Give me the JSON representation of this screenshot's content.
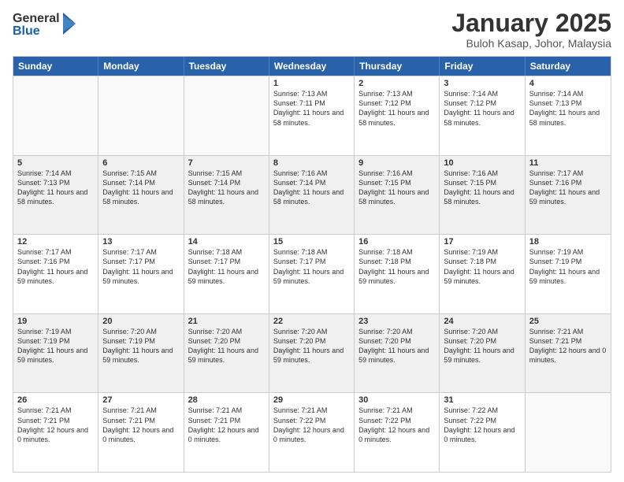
{
  "logo": {
    "general": "General",
    "blue": "Blue"
  },
  "header": {
    "title": "January 2025",
    "subtitle": "Buloh Kasap, Johor, Malaysia"
  },
  "days_of_week": [
    "Sunday",
    "Monday",
    "Tuesday",
    "Wednesday",
    "Thursday",
    "Friday",
    "Saturday"
  ],
  "weeks": [
    [
      {
        "day": "",
        "info": ""
      },
      {
        "day": "",
        "info": ""
      },
      {
        "day": "",
        "info": ""
      },
      {
        "day": "1",
        "info": "Sunrise: 7:13 AM\nSunset: 7:11 PM\nDaylight: 11 hours and 58 minutes."
      },
      {
        "day": "2",
        "info": "Sunrise: 7:13 AM\nSunset: 7:12 PM\nDaylight: 11 hours and 58 minutes."
      },
      {
        "day": "3",
        "info": "Sunrise: 7:14 AM\nSunset: 7:12 PM\nDaylight: 11 hours and 58 minutes."
      },
      {
        "day": "4",
        "info": "Sunrise: 7:14 AM\nSunset: 7:13 PM\nDaylight: 11 hours and 58 minutes."
      }
    ],
    [
      {
        "day": "5",
        "info": "Sunrise: 7:14 AM\nSunset: 7:13 PM\nDaylight: 11 hours and 58 minutes."
      },
      {
        "day": "6",
        "info": "Sunrise: 7:15 AM\nSunset: 7:14 PM\nDaylight: 11 hours and 58 minutes."
      },
      {
        "day": "7",
        "info": "Sunrise: 7:15 AM\nSunset: 7:14 PM\nDaylight: 11 hours and 58 minutes."
      },
      {
        "day": "8",
        "info": "Sunrise: 7:16 AM\nSunset: 7:14 PM\nDaylight: 11 hours and 58 minutes."
      },
      {
        "day": "9",
        "info": "Sunrise: 7:16 AM\nSunset: 7:15 PM\nDaylight: 11 hours and 58 minutes."
      },
      {
        "day": "10",
        "info": "Sunrise: 7:16 AM\nSunset: 7:15 PM\nDaylight: 11 hours and 58 minutes."
      },
      {
        "day": "11",
        "info": "Sunrise: 7:17 AM\nSunset: 7:16 PM\nDaylight: 11 hours and 59 minutes."
      }
    ],
    [
      {
        "day": "12",
        "info": "Sunrise: 7:17 AM\nSunset: 7:16 PM\nDaylight: 11 hours and 59 minutes."
      },
      {
        "day": "13",
        "info": "Sunrise: 7:17 AM\nSunset: 7:17 PM\nDaylight: 11 hours and 59 minutes."
      },
      {
        "day": "14",
        "info": "Sunrise: 7:18 AM\nSunset: 7:17 PM\nDaylight: 11 hours and 59 minutes."
      },
      {
        "day": "15",
        "info": "Sunrise: 7:18 AM\nSunset: 7:17 PM\nDaylight: 11 hours and 59 minutes."
      },
      {
        "day": "16",
        "info": "Sunrise: 7:18 AM\nSunset: 7:18 PM\nDaylight: 11 hours and 59 minutes."
      },
      {
        "day": "17",
        "info": "Sunrise: 7:19 AM\nSunset: 7:18 PM\nDaylight: 11 hours and 59 minutes."
      },
      {
        "day": "18",
        "info": "Sunrise: 7:19 AM\nSunset: 7:19 PM\nDaylight: 11 hours and 59 minutes."
      }
    ],
    [
      {
        "day": "19",
        "info": "Sunrise: 7:19 AM\nSunset: 7:19 PM\nDaylight: 11 hours and 59 minutes."
      },
      {
        "day": "20",
        "info": "Sunrise: 7:20 AM\nSunset: 7:19 PM\nDaylight: 11 hours and 59 minutes."
      },
      {
        "day": "21",
        "info": "Sunrise: 7:20 AM\nSunset: 7:20 PM\nDaylight: 11 hours and 59 minutes."
      },
      {
        "day": "22",
        "info": "Sunrise: 7:20 AM\nSunset: 7:20 PM\nDaylight: 11 hours and 59 minutes."
      },
      {
        "day": "23",
        "info": "Sunrise: 7:20 AM\nSunset: 7:20 PM\nDaylight: 11 hours and 59 minutes."
      },
      {
        "day": "24",
        "info": "Sunrise: 7:20 AM\nSunset: 7:20 PM\nDaylight: 11 hours and 59 minutes."
      },
      {
        "day": "25",
        "info": "Sunrise: 7:21 AM\nSunset: 7:21 PM\nDaylight: 12 hours and 0 minutes."
      }
    ],
    [
      {
        "day": "26",
        "info": "Sunrise: 7:21 AM\nSunset: 7:21 PM\nDaylight: 12 hours and 0 minutes."
      },
      {
        "day": "27",
        "info": "Sunrise: 7:21 AM\nSunset: 7:21 PM\nDaylight: 12 hours and 0 minutes."
      },
      {
        "day": "28",
        "info": "Sunrise: 7:21 AM\nSunset: 7:21 PM\nDaylight: 12 hours and 0 minutes."
      },
      {
        "day": "29",
        "info": "Sunrise: 7:21 AM\nSunset: 7:22 PM\nDaylight: 12 hours and 0 minutes."
      },
      {
        "day": "30",
        "info": "Sunrise: 7:21 AM\nSunset: 7:22 PM\nDaylight: 12 hours and 0 minutes."
      },
      {
        "day": "31",
        "info": "Sunrise: 7:22 AM\nSunset: 7:22 PM\nDaylight: 12 hours and 0 minutes."
      },
      {
        "day": "",
        "info": ""
      }
    ]
  ]
}
